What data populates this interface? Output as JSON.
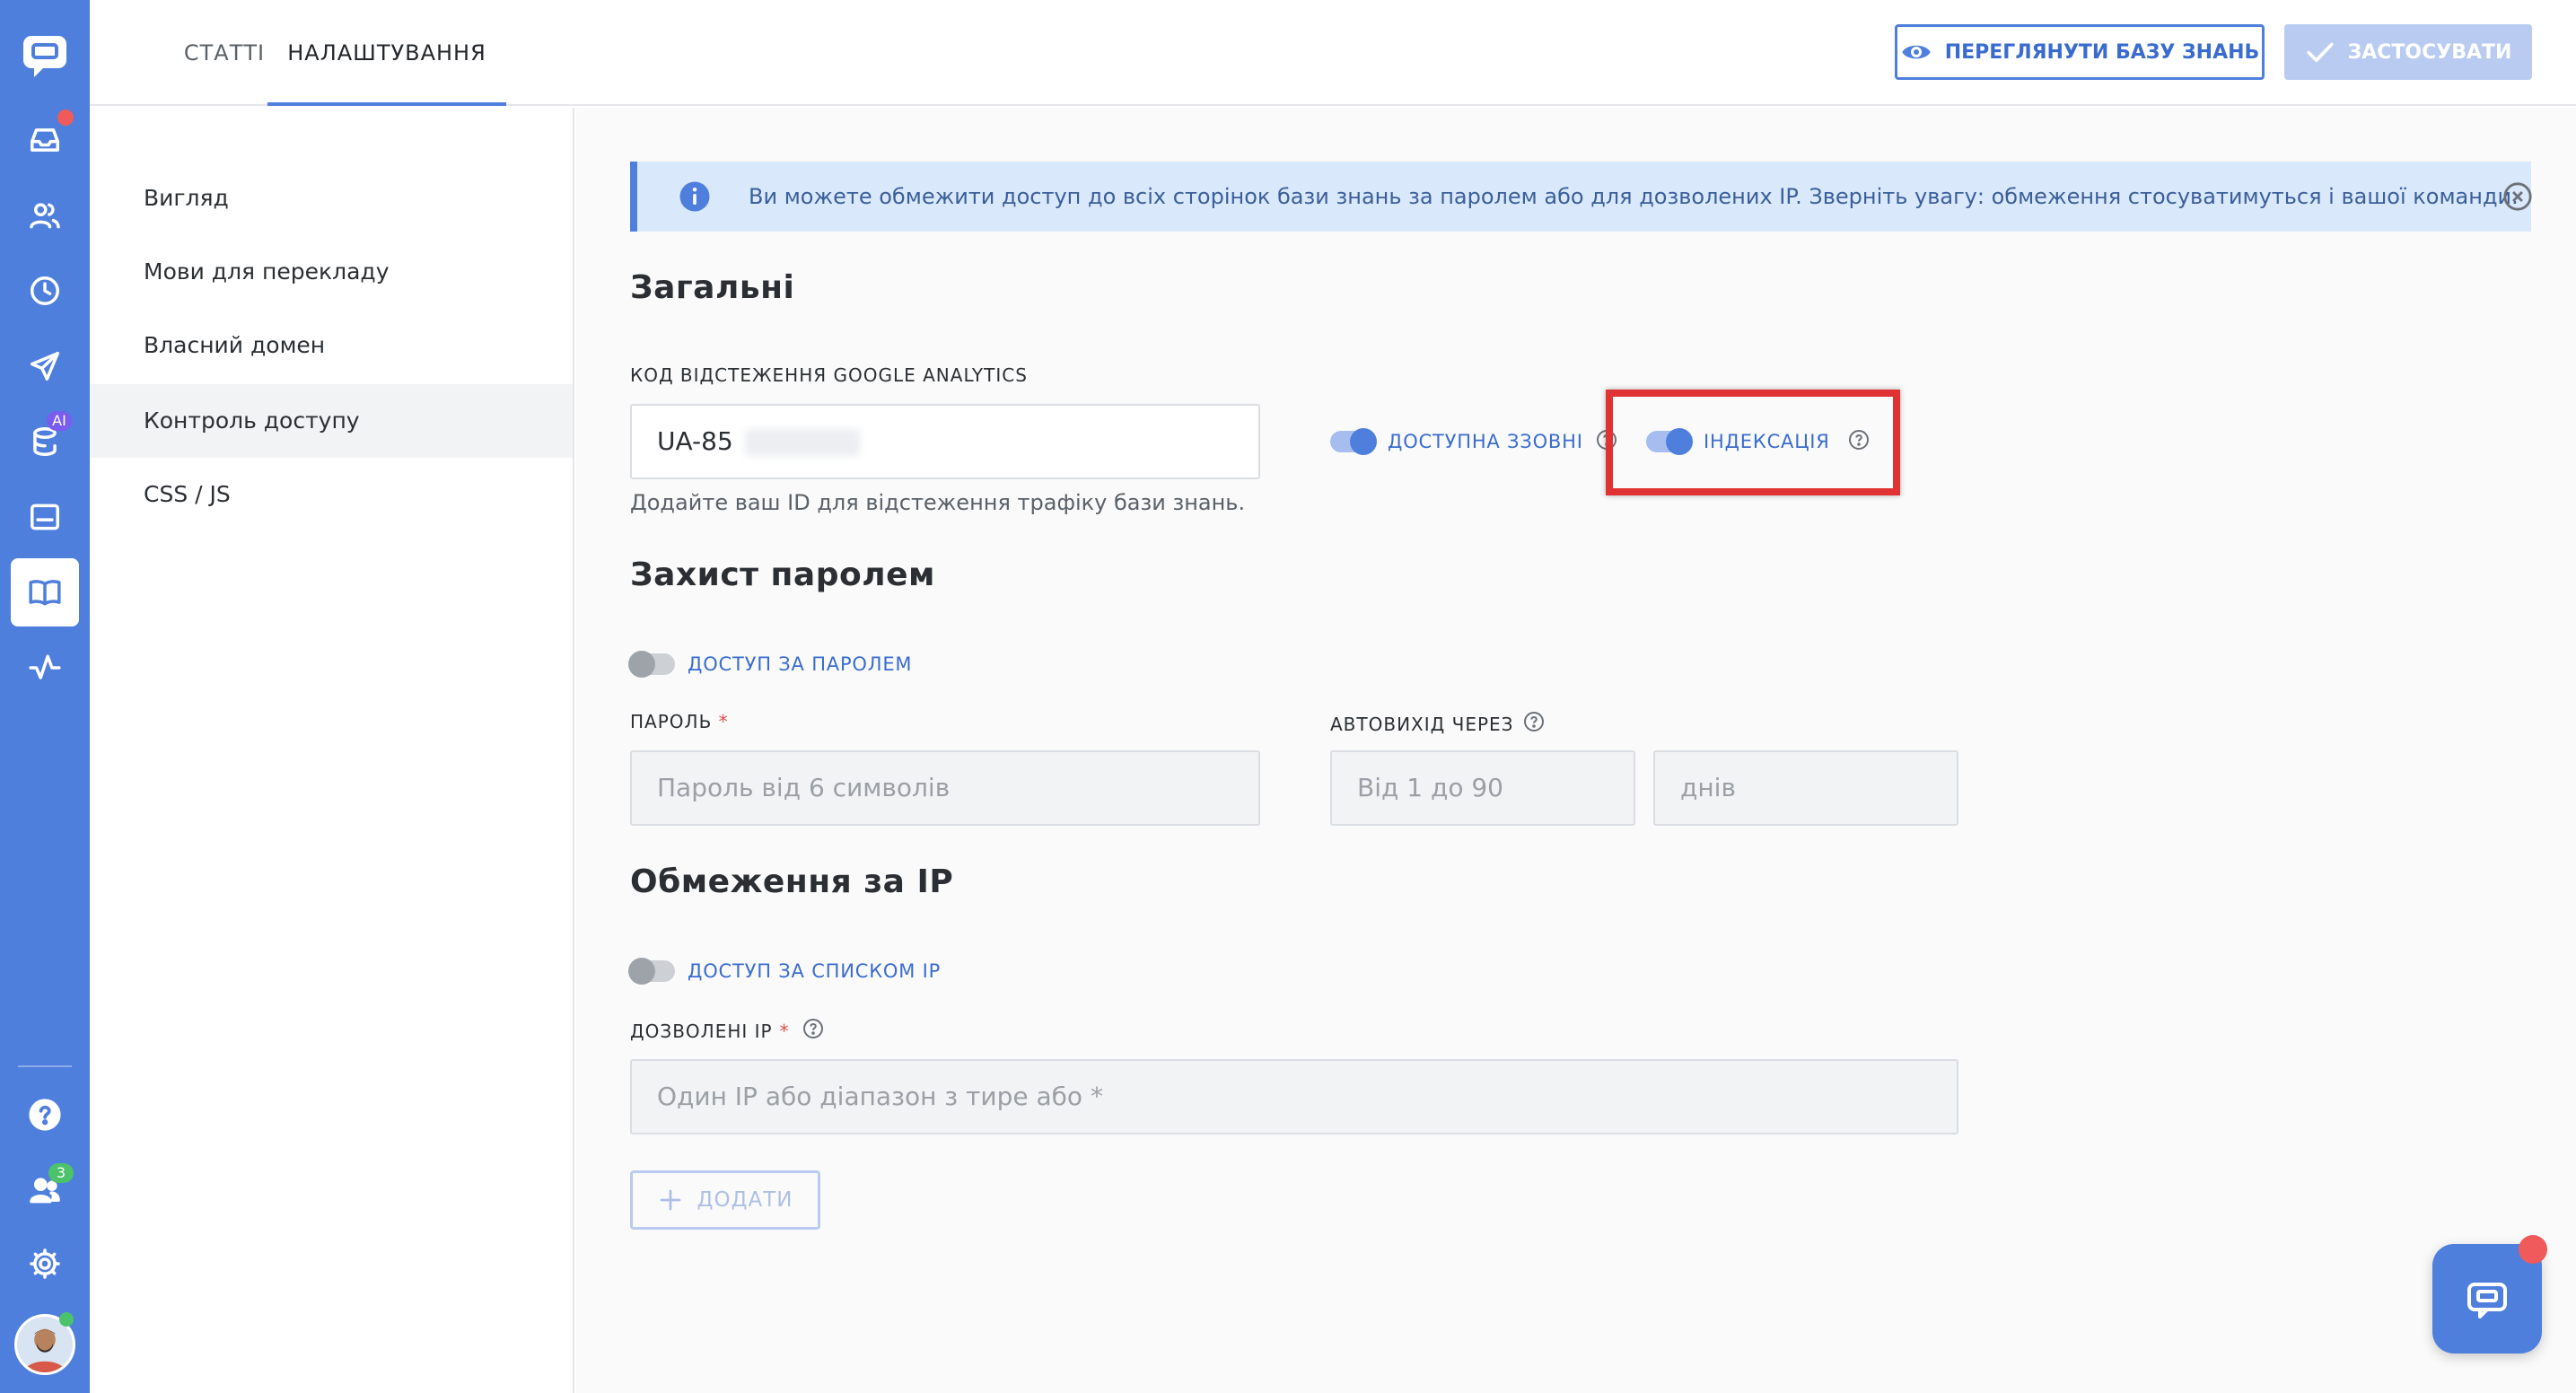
{
  "rail": {
    "ai_badge": "AI",
    "team_badge": "3"
  },
  "tabs": [
    {
      "label": "Статті"
    },
    {
      "label": "Налаштування"
    }
  ],
  "toolbar": {
    "view_label": "Переглянути базу знань",
    "apply_label": "Застосувати"
  },
  "menu": {
    "items": [
      {
        "label": "Вигляд"
      },
      {
        "label": "Мови для перекладу"
      },
      {
        "label": "Власний домен"
      },
      {
        "label": "Контроль доступу"
      },
      {
        "label": "CSS / JS"
      }
    ]
  },
  "banner": {
    "text": "Ви можете обмежити доступ до всіх сторінок бази знань за паролем або для дозволених IP. Зверніть увагу: обмеження стосуватимуться і вашої команди."
  },
  "general": {
    "title": "Загальні",
    "ga_label": "Код відстеження Google Analytics",
    "ga_value": "UA-85",
    "ga_hint": "Додайте ваш ID для відстеження трафіку бази знань.",
    "public_toggle": "Доступна ззовні",
    "index_toggle": "Індексація"
  },
  "password": {
    "title": "Захист паролем",
    "toggle": "Доступ за паролем",
    "password_label": "Пароль",
    "password_placeholder": "Пароль від 6 символів",
    "logout_label": "Автовихід через",
    "logout_placeholder": "Від 1 до 90",
    "days_placeholder": "днів",
    "required_mark": "*"
  },
  "ip": {
    "title": "Обмеження за IP",
    "toggle": "Доступ за списком IP",
    "allowed_label": "Дозволені IP",
    "allowed_placeholder": "Один IP або діапазон з тире або *",
    "add_label": "Додати",
    "required_mark": "*"
  },
  "colors": {
    "accent": "#4f7fdc",
    "banner_bg": "#dae8fb",
    "highlight": "#e03232"
  }
}
